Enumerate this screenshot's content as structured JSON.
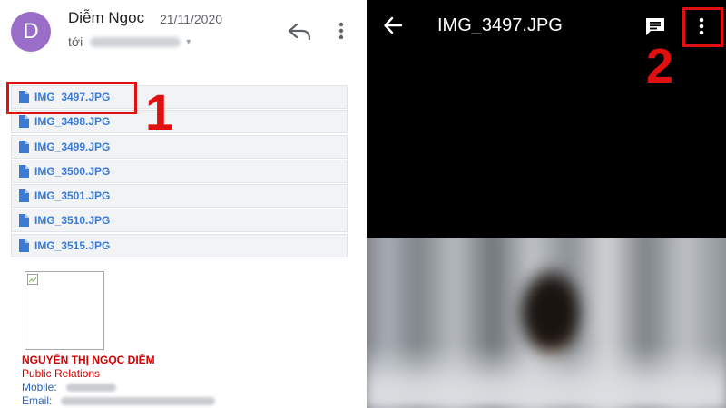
{
  "email": {
    "avatar_letter": "D",
    "sender": "Diễm Ngọc",
    "date": "21/11/2020",
    "to_label": "tới",
    "attachments": [
      {
        "name": "IMG_3497.JPG"
      },
      {
        "name": "IMG_3498.JPG"
      },
      {
        "name": "IMG_3499.JPG"
      },
      {
        "name": "IMG_3500.JPG"
      },
      {
        "name": "IMG_3501.JPG"
      },
      {
        "name": "IMG_3510.JPG"
      },
      {
        "name": "IMG_3515.JPG"
      }
    ],
    "signature": {
      "name": "NGUYỄN THỊ NGỌC DIỄM",
      "role": "Public Relations",
      "mobile_label": "Mobile:",
      "email_label": "Email:"
    }
  },
  "viewer": {
    "title": "IMG_3497.JPG"
  },
  "annotations": {
    "step1": "1",
    "step2": "2",
    "highlight_color": "#e01010"
  },
  "colors": {
    "avatar": "#9a6dc8",
    "attachment_link": "#3b7bd6",
    "signature_red": "#d40000"
  },
  "icons": {
    "reply": "reply-icon",
    "more_left": "more-vert-icon",
    "file": "file-icon",
    "back": "arrow-back-icon",
    "comment": "comment-icon",
    "more_right": "more-vert-icon"
  }
}
